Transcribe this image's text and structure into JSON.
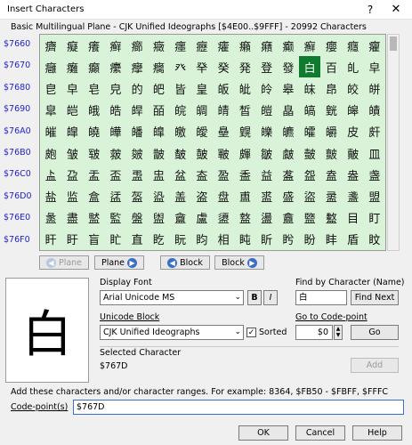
{
  "window": {
    "title": "Insert Characters",
    "help_glyph": "?",
    "close_glyph": "✕"
  },
  "plane_info": "Basic Multilingual Plane - CJK Unified Ideographs [$4E00..$9FFF] - 20992 Characters",
  "row_labels": [
    "$7660",
    "$7670",
    "$7680",
    "$7690",
    "$76A0",
    "$76B0",
    "$76C0",
    "$76D0",
    "$76E0",
    "$76F0"
  ],
  "grid_rows": [
    [
      "癠",
      "癡",
      "癢",
      "癣",
      "癤",
      "癥",
      "癦",
      "癧",
      "癨",
      "癩",
      "癪",
      "癫",
      "癬",
      "癭",
      "癮",
      "癯"
    ],
    [
      "癰",
      "癱",
      "癲",
      "癳",
      "癴",
      "癵",
      "癶",
      "癷",
      "癸",
      "発",
      "登",
      "發",
      "白",
      "百",
      "癿",
      "皁"
    ],
    [
      "皀",
      "皁",
      "皂",
      "皃",
      "的",
      "皅",
      "皆",
      "皇",
      "皈",
      "皉",
      "皊",
      "皋",
      "皌",
      "皍",
      "皎",
      "皏"
    ],
    [
      "皐",
      "皑",
      "皒",
      "皓",
      "皔",
      "皕",
      "皖",
      "皗",
      "皘",
      "皙",
      "皚",
      "皛",
      "皜",
      "皝",
      "皞",
      "皟"
    ],
    [
      "皠",
      "皡",
      "皢",
      "皣",
      "皤",
      "皥",
      "皦",
      "皧",
      "皨",
      "皩",
      "皪",
      "皫",
      "皬",
      "皭",
      "皮",
      "皯"
    ],
    [
      "皰",
      "皱",
      "皲",
      "皳",
      "皴",
      "皵",
      "皶",
      "皷",
      "皸",
      "皹",
      "皺",
      "皻",
      "皼",
      "皽",
      "皾",
      "皿"
    ],
    [
      "盀",
      "盁",
      "盂",
      "盃",
      "盄",
      "盅",
      "盆",
      "盇",
      "盈",
      "盉",
      "益",
      "盋",
      "盌",
      "盍",
      "盎",
      "盏"
    ],
    [
      "盐",
      "监",
      "盒",
      "盓",
      "盔",
      "盕",
      "盖",
      "盗",
      "盘",
      "盙",
      "盚",
      "盛",
      "盜",
      "盝",
      "盞",
      "盟"
    ],
    [
      "盠",
      "盡",
      "盢",
      "監",
      "盤",
      "盥",
      "盦",
      "盧",
      "盨",
      "盩",
      "盪",
      "盫",
      "盬",
      "盭",
      "目",
      "盯"
    ],
    [
      "盰",
      "盱",
      "盲",
      "盳",
      "直",
      "盵",
      "盶",
      "盷",
      "相",
      "盹",
      "盺",
      "盻",
      "盼",
      "盽",
      "盾",
      "盿"
    ]
  ],
  "selected_cell": {
    "row": 1,
    "col": 12
  },
  "nav": {
    "plane_prev": "Plane",
    "plane_next": "Plane",
    "block_prev": "Block",
    "block_next": "Block",
    "left_arrow": "◀",
    "right_arrow": "▶"
  },
  "preview_char": "白",
  "display_font": {
    "label": "Display Font",
    "value": "Arial Unicode MS",
    "bold": "B",
    "italic": "I"
  },
  "find": {
    "label": "Find by Character (Name)",
    "value": "白",
    "button": "Find Next"
  },
  "unicode_block": {
    "label": "Unicode Block",
    "value": "CJK Unified Ideographs",
    "sorted_label": "Sorted",
    "sorted_checked": "✓"
  },
  "goto": {
    "label": "Go to Code-point",
    "value": "$0",
    "button": "Go"
  },
  "selected_character": {
    "label": "Selected Character",
    "value": "$767D",
    "add_button": "Add"
  },
  "add_info": "Add these characters and/or character ranges. For example: 8364, $FB50 - $FBFF, $FFFC",
  "codepoints": {
    "label": "Code-point(s)",
    "value": "$767D"
  },
  "buttons": {
    "ok": "OK",
    "cancel": "Cancel",
    "help": "Help"
  },
  "dropdown_arrow": "⌄",
  "spin_up": "▲",
  "spin_down": "▼"
}
